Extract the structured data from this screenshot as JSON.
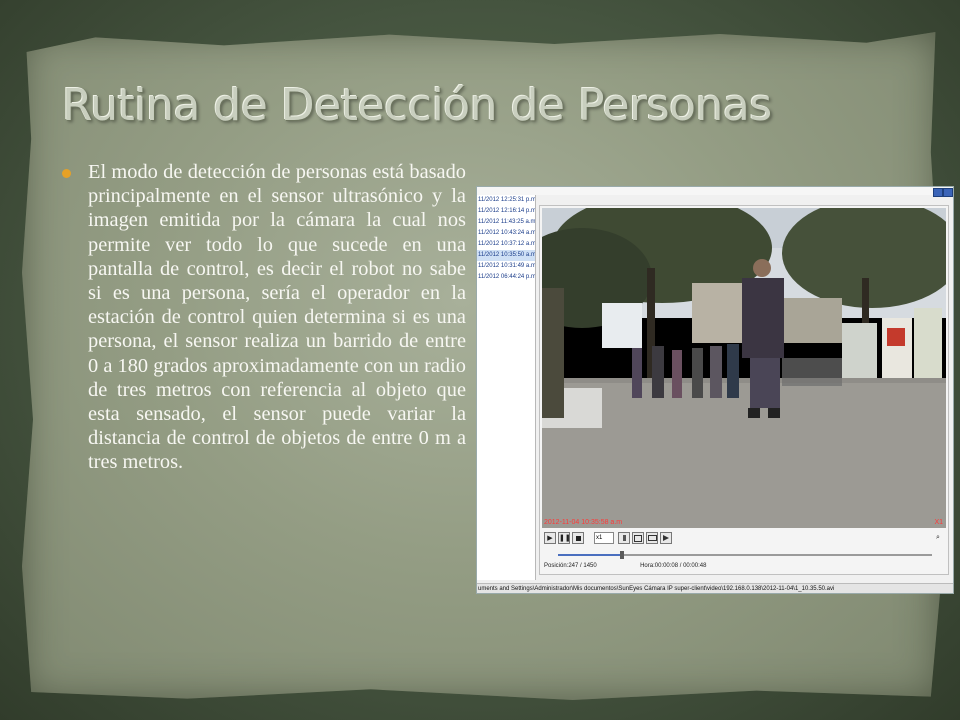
{
  "slide": {
    "title": "Rutina de Detección de Personas",
    "bullet": "El modo de detección de personas está basado principalmente en el sensor ultrasónico y la imagen emitida por la cámara la cual nos permite ver todo lo que sucede en una pantalla de control, es decir el robot no sabe si es una persona, sería el operador en la estación de control quien determina si es una persona, el sensor realiza un barrido de entre 0 a 180 grados aproximadamente con un radio de tres metros con referencia al objeto que esta sensado, el sensor puede variar la distancia de control de objetos de entre 0 m a tres metros."
  },
  "screenshot": {
    "files": [
      {
        "label": "11/2012 12:25:31 p.m"
      },
      {
        "label": "11/2012 12:16:14 p.m"
      },
      {
        "label": "11/2012 11:43:25 a.m"
      },
      {
        "label": "11/2012 10:43:24 a.m"
      },
      {
        "label": "11/2012 10:37:12 a.m"
      },
      {
        "label": "11/2012 10:35:50 a.m",
        "selected": true
      },
      {
        "label": "11/2012 10:31:49 a.m"
      },
      {
        "label": "11/2012 06:44:24 p.m"
      }
    ],
    "video_timestamp": "2012-11-04 10:35:58 a.m",
    "video_zoom": "X1",
    "speed": "x1",
    "seek_progress": 0.17,
    "position_text": "Posición:247 / 1450",
    "time_text": "Hora:00:00:08 / 00:00:48",
    "status_path": "uments and Settings\\Administrador\\Mis documentos\\SunEyes Cámara IP super-client\\video\\192.168.0.138\\2012-11-04\\1_10.35.50.avi",
    "icons": {
      "play": "▶",
      "pause": "❚❚",
      "stop": "■",
      "zoom": "⌕"
    }
  },
  "colors": {
    "accent": "#e6a127",
    "timestamp": "#ff3838"
  }
}
